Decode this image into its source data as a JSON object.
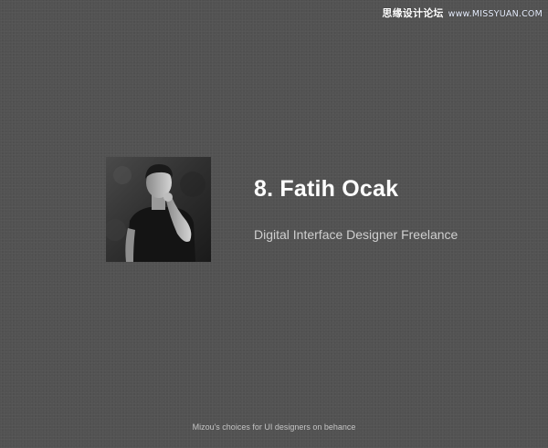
{
  "watermark": {
    "site_name": "思缘设计论坛",
    "url": "www.MISSYUAN.COM"
  },
  "profile": {
    "title": "8. Fatih Ocak",
    "subtitle": "Digital Interface Designer Freelance"
  },
  "footer": {
    "text": "Mizou's choices for UI designers on behance"
  },
  "colors": {
    "background": "#525252",
    "title": "#ffffff",
    "subtitle": "#cfcfcf",
    "footer": "#c4c4c4"
  }
}
